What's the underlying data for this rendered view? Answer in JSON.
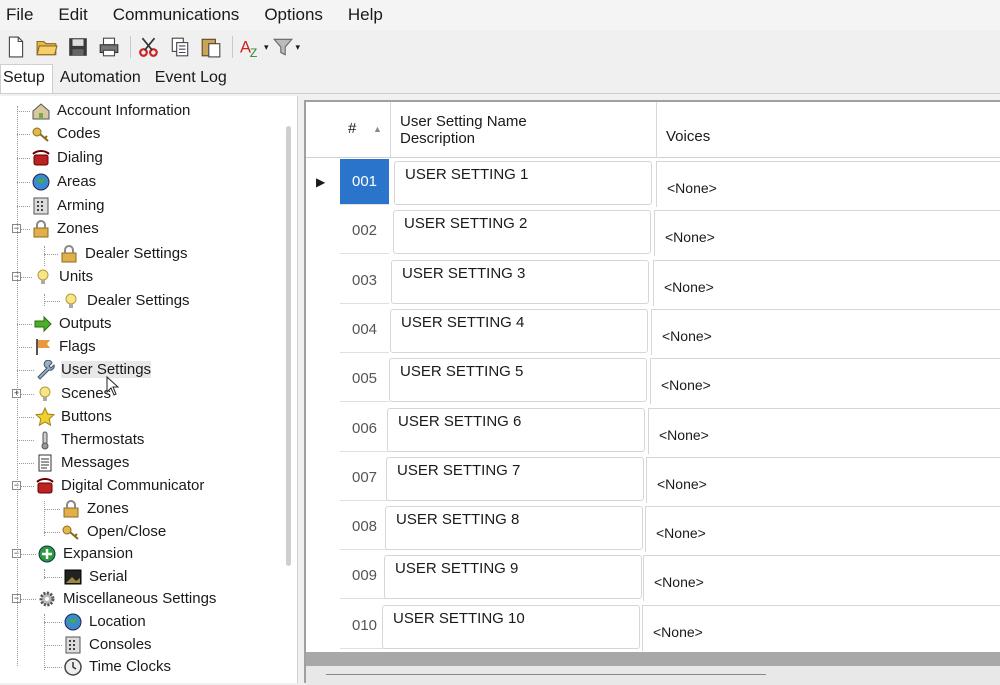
{
  "menu": [
    "File",
    "Edit",
    "Communications",
    "Options",
    "Help"
  ],
  "tabs": [
    "Setup",
    "Automation",
    "Event Log"
  ],
  "active_tab": "Setup",
  "tree": [
    {
      "label": "Account Information",
      "icon": "house-icon"
    },
    {
      "label": "Codes",
      "icon": "key-icon"
    },
    {
      "label": "Dialing",
      "icon": "phone-icon"
    },
    {
      "label": "Areas",
      "icon": "globe-icon"
    },
    {
      "label": "Arming",
      "icon": "keypad-icon"
    },
    {
      "label": "Zones",
      "icon": "lock-icon"
    },
    {
      "label": "Dealer Settings",
      "icon": "lock-icon"
    },
    {
      "label": "Units",
      "icon": "bulb-icon"
    },
    {
      "label": "Dealer Settings",
      "icon": "bulb-icon"
    },
    {
      "label": "Outputs",
      "icon": "arrow-icon"
    },
    {
      "label": "Flags",
      "icon": "flag-icon"
    },
    {
      "label": "User Settings",
      "icon": "wrench-icon"
    },
    {
      "label": "Scenes",
      "icon": "bulb-icon"
    },
    {
      "label": "Buttons",
      "icon": "star-icon"
    },
    {
      "label": "Thermostats",
      "icon": "thermometer-icon"
    },
    {
      "label": "Messages",
      "icon": "document-icon"
    },
    {
      "label": "Digital Communicator",
      "icon": "phone-icon"
    },
    {
      "label": "Zones",
      "icon": "lock-icon"
    },
    {
      "label": "Open/Close",
      "icon": "key-icon"
    },
    {
      "label": "Expansion",
      "icon": "plus-circle-icon"
    },
    {
      "label": "Serial",
      "icon": "monitor-icon"
    },
    {
      "label": "Miscellaneous Settings",
      "icon": "gear-icon"
    },
    {
      "label": "Location",
      "icon": "globe-icon"
    },
    {
      "label": "Consoles",
      "icon": "keypad-icon"
    },
    {
      "label": "Time Clocks",
      "icon": "clock-icon"
    }
  ],
  "grid": {
    "header_num": "#",
    "header_name_line1": "User Setting Name",
    "header_name_line2": "Description",
    "header_voices": "Voices",
    "rows": [
      {
        "num": "001",
        "name": "USER SETTING 1",
        "voices": "<None>"
      },
      {
        "num": "002",
        "name": "USER SETTING 2",
        "voices": "<None>"
      },
      {
        "num": "003",
        "name": "USER SETTING 3",
        "voices": "<None>"
      },
      {
        "num": "004",
        "name": "USER SETTING 4",
        "voices": "<None>"
      },
      {
        "num": "005",
        "name": "USER SETTING 5",
        "voices": "<None>"
      },
      {
        "num": "006",
        "name": "USER SETTING 6",
        "voices": "<None>"
      },
      {
        "num": "007",
        "name": "USER SETTING 7",
        "voices": "<None>"
      },
      {
        "num": "008",
        "name": "USER SETTING 8",
        "voices": "<None>"
      },
      {
        "num": "009",
        "name": "USER SETTING 9",
        "voices": "<None>"
      },
      {
        "num": "010",
        "name": "USER SETTING 10",
        "voices": "<None>"
      }
    ]
  }
}
